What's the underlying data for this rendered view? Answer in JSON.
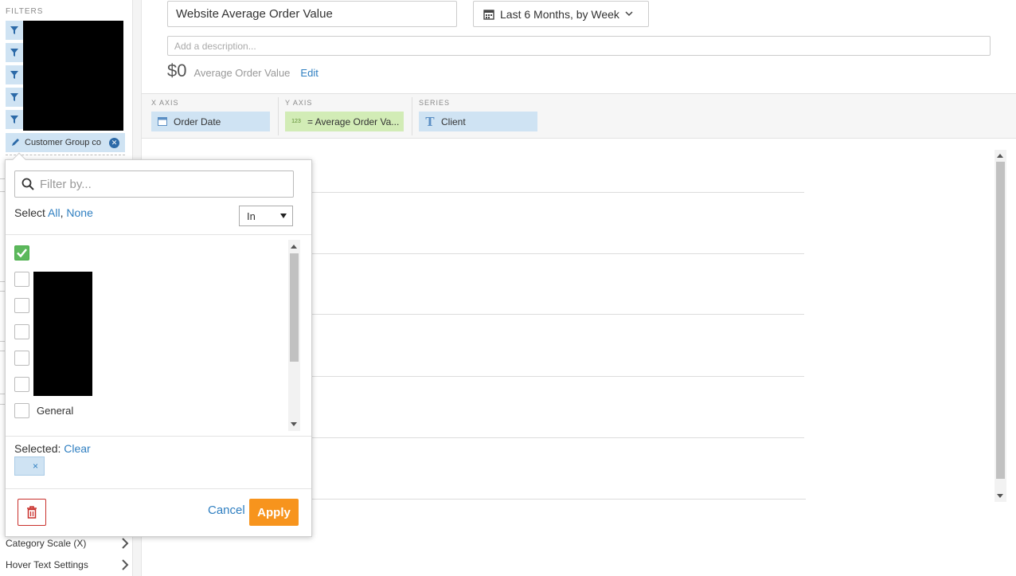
{
  "sidebar": {
    "filters_label": "FILTERS",
    "custom_filter_label": "Customer Group co",
    "rows": [
      {
        "label": "Category Scale (X)"
      },
      {
        "label": "Hover Text Settings"
      }
    ]
  },
  "header": {
    "title_value": "Website Average Order Value",
    "date_range_label": "Last 6 Months, by Week",
    "description_placeholder": "Add a description...",
    "kpi_value": "$0",
    "kpi_label": "Average Order Value",
    "kpi_edit": "Edit"
  },
  "axes": {
    "x_label": "X AXIS",
    "x_field": "Order Date",
    "y_label": "Y AXIS",
    "y_field": "= Average Order Va...",
    "series_label": "SERIES",
    "series_field": "Client"
  },
  "popup": {
    "filter_placeholder": "Filter by...",
    "select_prefix": "Select",
    "select_all": "All",
    "select_none": "None",
    "operator": "In",
    "visible_item_label": "General",
    "selected_prefix": "Selected:",
    "clear_label": "Clear",
    "selected_chip_remove": "×",
    "cancel_label": "Cancel",
    "apply_label": "Apply"
  },
  "colors": {
    "accent_blue": "#2f7fc1",
    "apply_orange": "#f7941d",
    "check_green": "#5cb85c",
    "delete_red": "#c9302c"
  }
}
